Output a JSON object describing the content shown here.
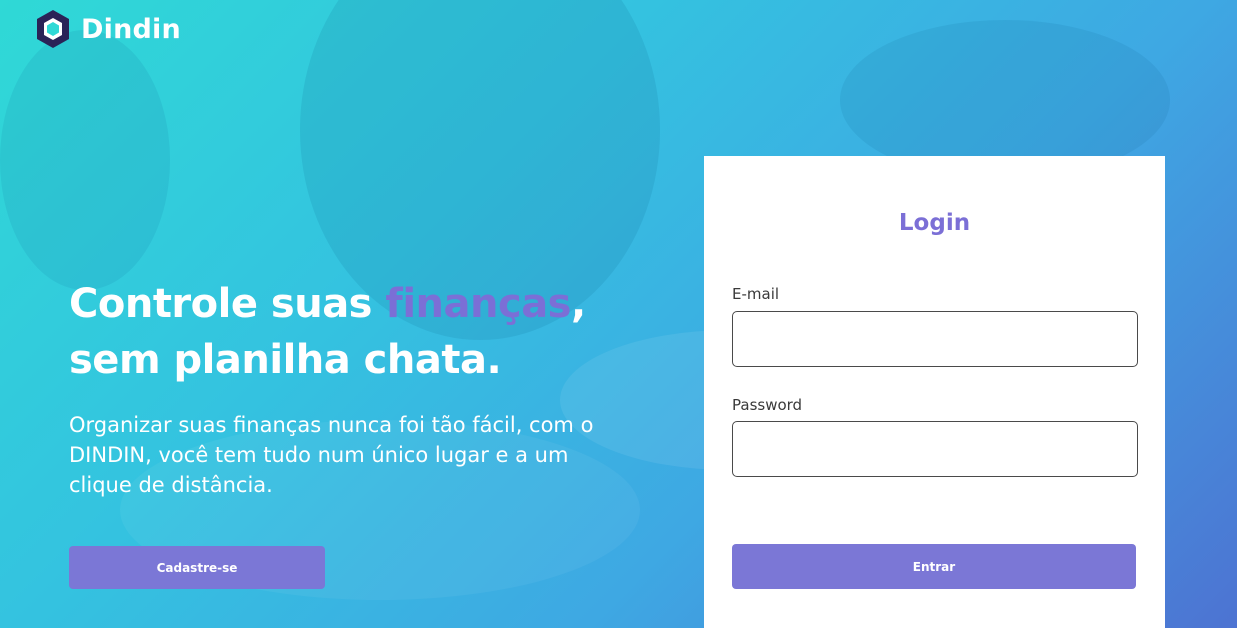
{
  "brand": {
    "name": "Dindin"
  },
  "hero": {
    "headline_part1": "Controle suas ",
    "headline_accent": "finanças",
    "headline_part2": ",",
    "headline_line2": "sem planilha chata.",
    "subtitle": "Organizar suas finanças nunca foi tão fácil, com o DINDIN, você tem tudo num único lugar e a um clique de distância.",
    "signup_label": "Cadastre-se"
  },
  "login": {
    "title": "Login",
    "email_label": "E-mail",
    "email_value": "",
    "password_label": "Password",
    "password_value": "",
    "submit_label": "Entrar"
  },
  "colors": {
    "accent": "#7b77d6",
    "title_accent": "#7b6fd6",
    "background_start": "#2fd9d6",
    "background_end": "#4d73d2",
    "logo_dark": "#2a2357"
  }
}
